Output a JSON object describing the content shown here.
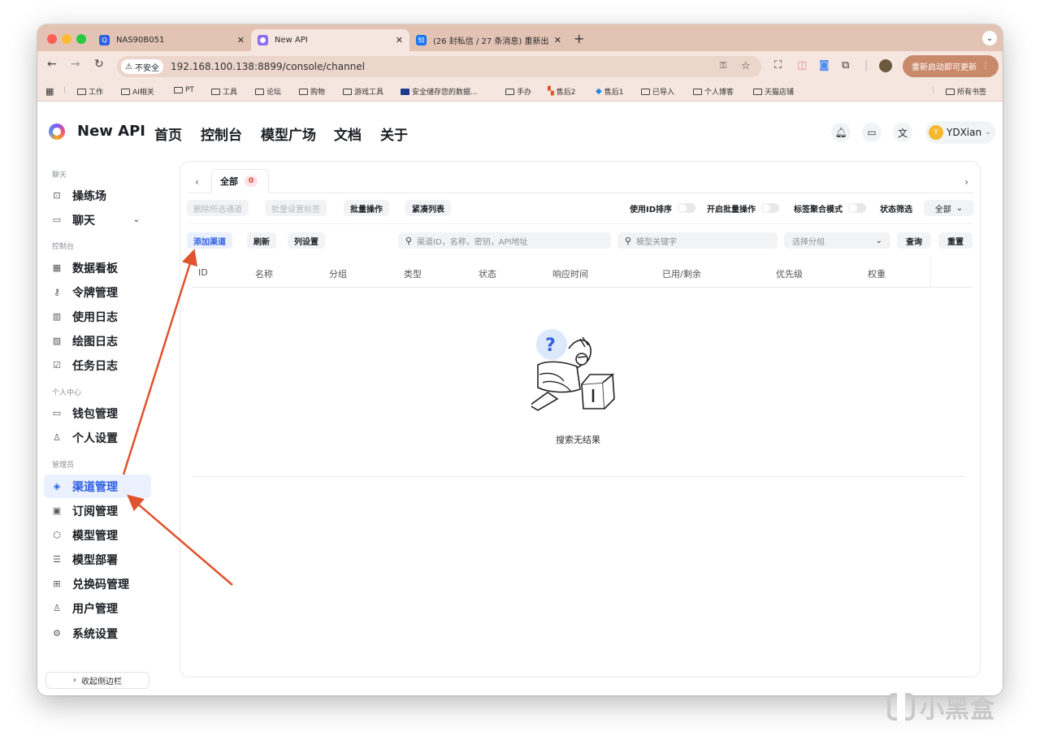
{
  "browser": {
    "tabs": [
      {
        "icon": "Q",
        "title": "NAS90B051",
        "icon_color": "#2e62e6"
      },
      {
        "icon": "",
        "title": "New API",
        "icon_color": "#8a6cf4"
      },
      {
        "icon": "知",
        "title": "(26 封私信 / 27 条消息) 重新出",
        "icon_color": "#1772f6"
      }
    ],
    "new_tab": "+",
    "url": "192.168.100.138:8899/console/channel",
    "security_label": "不安全",
    "update_button": "重新启动即可更新",
    "bookmarks": [
      {
        "label": "工作",
        "icon": "folder"
      },
      {
        "label": "AI相关",
        "icon": "folder"
      },
      {
        "label": "PT",
        "icon": "folder"
      },
      {
        "label": "工具",
        "icon": "folder"
      },
      {
        "label": "论坛",
        "icon": "folder"
      },
      {
        "label": "购物",
        "icon": "folder"
      },
      {
        "label": "游戏工具",
        "icon": "folder"
      },
      {
        "label": "安全储存您的数据...",
        "icon": "app"
      },
      {
        "label": "手办",
        "icon": "folder"
      },
      {
        "label": "售后2",
        "icon": "windows"
      },
      {
        "label": "售后1",
        "icon": "app"
      },
      {
        "label": "已导入",
        "icon": "folder"
      },
      {
        "label": "个人博客",
        "icon": "folder"
      },
      {
        "label": "天猫店铺",
        "icon": "folder"
      }
    ],
    "all_bookmarks": "所有书签"
  },
  "app": {
    "brand": "New API",
    "nav": [
      "首页",
      "控制台",
      "模型广场",
      "文档",
      "关于"
    ],
    "user": {
      "initial": "Y",
      "name": "YDXian"
    }
  },
  "sidebar": {
    "sections": [
      "聊天",
      "控制台",
      "个人中心",
      "管理员"
    ],
    "items": [
      {
        "label": "操练场",
        "icon": "playground"
      },
      {
        "label": "聊天",
        "icon": "chat"
      },
      {
        "label": "数据看板",
        "icon": "dashboard"
      },
      {
        "label": "令牌管理",
        "icon": "key"
      },
      {
        "label": "使用日志",
        "icon": "chart"
      },
      {
        "label": "绘图日志",
        "icon": "image"
      },
      {
        "label": "任务日志",
        "icon": "check"
      },
      {
        "label": "钱包管理",
        "icon": "wallet"
      },
      {
        "label": "个人设置",
        "icon": "user"
      },
      {
        "label": "渠道管理",
        "icon": "layers"
      },
      {
        "label": "订阅管理",
        "icon": "calendar"
      },
      {
        "label": "模型管理",
        "icon": "cube"
      },
      {
        "label": "模型部署",
        "icon": "server"
      },
      {
        "label": "兑换码管理",
        "icon": "gift"
      },
      {
        "label": "用户管理",
        "icon": "user"
      },
      {
        "label": "系统设置",
        "icon": "gear"
      }
    ],
    "collapse": "收起侧边栏"
  },
  "channel": {
    "tab_label": "全部",
    "tab_count": "0",
    "actions": [
      "删除所选通道",
      "批量设置标签",
      "批量操作",
      "紧凑列表"
    ],
    "toggles": [
      "使用ID排序",
      "开启批量操作",
      "标签聚合模式"
    ],
    "status_filter_label": "状态筛选",
    "status_filter_value": "全部",
    "toolbar_buttons": [
      "添加渠道",
      "刷新",
      "列设置"
    ],
    "search_placeholder": "渠道ID，名称，密钥，API地址",
    "model_placeholder": "模型关键字",
    "group_placeholder": "选择分组",
    "query": "查询",
    "reset": "重置",
    "columns": [
      "ID",
      "名称",
      "分组",
      "类型",
      "状态",
      "响应时间",
      "已用/剩余",
      "优先级",
      "权重"
    ],
    "empty_text": "搜索无结果"
  },
  "watermark": "小黑盒",
  "colors": {
    "accent": "#2f5fe1",
    "tab_bar": "#e2c3b4",
    "arrow": "#e0532f"
  }
}
